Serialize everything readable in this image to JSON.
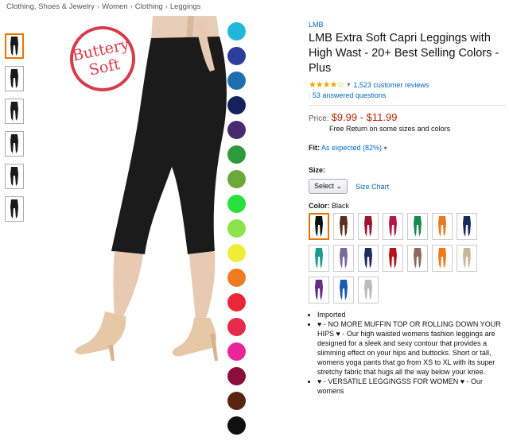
{
  "breadcrumb": [
    "Clothing, Shoes & Jewelry",
    "Women",
    "Clothing",
    "Leggings"
  ],
  "badge": {
    "line1": "Buttery",
    "line2": "Soft"
  },
  "product": {
    "brand": "LMB",
    "title": "LMB Extra Soft Capri Leggings with High Wast - 20+ Best Selling Colors - Plus",
    "rating_stars": "★★★★☆",
    "reviews": "1,523 customer reviews",
    "answered": "53 answered questions",
    "price_label": "Price:",
    "price": "$9.99 - $11.99",
    "free_return": "Free Return on some sizes and colors",
    "fit_label": "Fit:",
    "fit_value": "As expected (82%)",
    "size_label": "Size:",
    "size_select": "Select",
    "size_chart": "Size Chart",
    "color_label": "Color:",
    "color_value": "Black"
  },
  "swatch_dots": [
    "#22b6d8",
    "#2c3d9a",
    "#1e6fb0",
    "#15205e",
    "#4a2a6e",
    "#2e9a3c",
    "#6aa83a",
    "#29e03c",
    "#8ce34c",
    "#eeee3a",
    "#f07a22",
    "#e8283a",
    "#e52a4a",
    "#e8259a",
    "#8b0e3c",
    "#5a2510",
    "#101010"
  ],
  "thumb_colors": [
    "#1a1a1a",
    "#1a1a1a",
    "#1a1a1a",
    "#1a1a1a",
    "#1a1a1a",
    "#1a1a1a"
  ],
  "color_options": [
    "#111111",
    "#5b2e1e",
    "#9e1530",
    "#b01b4a",
    "#1a8a4a",
    "#e87a22",
    "#172a5a",
    "#1b9a8e",
    "#7a6a9a",
    "#1c2d5c",
    "#b5141e",
    "#8a6a5a",
    "#f07a1a",
    "#c8b898",
    "#6a2a8a",
    "#1a5ab0",
    "#bcbcbc"
  ],
  "bullets": [
    "Imported",
    "♥ - NO MORE MUFFIN TOP OR ROLLING DOWN YOUR HIPS ♥ - Our high waisted womens fashion leggings are designed for a sleek and sexy contour that provides a slimming effect on your hips and buttocks. Short or tall, womens yoga pants that go from XS to XL with its super stretchy fabric that hugs all the way below your knee.",
    "♥ - VERSATILE LEGGINGSS FOR WOMEN ♥ - Our womens"
  ]
}
